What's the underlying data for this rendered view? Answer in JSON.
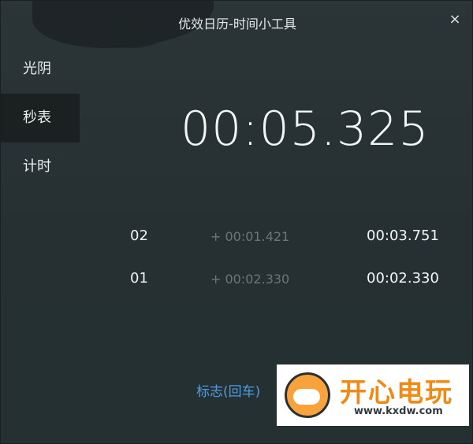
{
  "window": {
    "title": "优效日历-时间小工具",
    "close_glyph": "×"
  },
  "sidebar": {
    "items": [
      {
        "label": "光阴",
        "active": false
      },
      {
        "label": "秒表",
        "active": true
      },
      {
        "label": "计时",
        "active": false
      }
    ]
  },
  "stopwatch": {
    "elapsed": "00:05.325",
    "laps": [
      {
        "number": "02",
        "split": "+ 00:01.421",
        "total": "00:03.751"
      },
      {
        "number": "01",
        "split": "+ 00:02.330",
        "total": "00:02.330"
      }
    ],
    "mark_button_label": "标志(回车)"
  },
  "watermark": {
    "title": "开心电玩",
    "url": "www.kxdw.com"
  },
  "colors": {
    "background": "#263032",
    "sidebar_active": "#1b2021",
    "link": "#4e9de0",
    "split_text": "#6b7678"
  }
}
